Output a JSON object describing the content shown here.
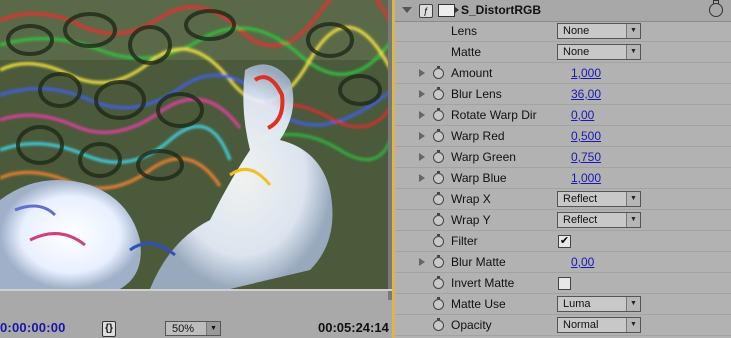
{
  "viewer": {
    "timecode_current": "0:00:00:00",
    "frame_button": "{}",
    "zoom": "50%",
    "timecode_duration": "00:05:24:14"
  },
  "effect": {
    "name": "S_DistortRGB",
    "params": [
      {
        "label": "Lens",
        "kind": "dropdown",
        "value": "None",
        "twirl": false,
        "stopwatch": false
      },
      {
        "label": "Matte",
        "kind": "dropdown",
        "value": "None",
        "twirl": false,
        "stopwatch": false
      },
      {
        "label": "Amount",
        "kind": "number",
        "value": "1,000",
        "twirl": true,
        "stopwatch": true
      },
      {
        "label": "Blur Lens",
        "kind": "number",
        "value": "36,00",
        "twirl": true,
        "stopwatch": true
      },
      {
        "label": "Rotate Warp Dir",
        "kind": "number",
        "value": "0,00",
        "twirl": true,
        "stopwatch": true
      },
      {
        "label": "Warp Red",
        "kind": "number",
        "value": "0,500",
        "twirl": true,
        "stopwatch": true
      },
      {
        "label": "Warp Green",
        "kind": "number",
        "value": "0,750",
        "twirl": true,
        "stopwatch": true
      },
      {
        "label": "Warp Blue",
        "kind": "number",
        "value": "1,000",
        "twirl": true,
        "stopwatch": true
      },
      {
        "label": "Wrap X",
        "kind": "dropdown",
        "value": "Reflect",
        "twirl": false,
        "stopwatch": true
      },
      {
        "label": "Wrap Y",
        "kind": "dropdown",
        "value": "Reflect",
        "twirl": false,
        "stopwatch": true
      },
      {
        "label": "Filter",
        "kind": "checkbox",
        "value": "checked",
        "twirl": false,
        "stopwatch": true
      },
      {
        "label": "Blur Matte",
        "kind": "number",
        "value": "0,00",
        "twirl": true,
        "stopwatch": true
      },
      {
        "label": "Invert Matte",
        "kind": "checkbox",
        "value": "unchecked",
        "twirl": false,
        "stopwatch": true
      },
      {
        "label": "Matte Use",
        "kind": "dropdown",
        "value": "Luma",
        "twirl": false,
        "stopwatch": true
      },
      {
        "label": "Opacity",
        "kind": "dropdown",
        "value": "Normal",
        "twirl": false,
        "stopwatch": true
      }
    ]
  },
  "colors": {
    "timecode_blue": "#1616a8",
    "value_link_blue": "#1a1ab0",
    "panel_border_gold": "#d8b74c"
  }
}
